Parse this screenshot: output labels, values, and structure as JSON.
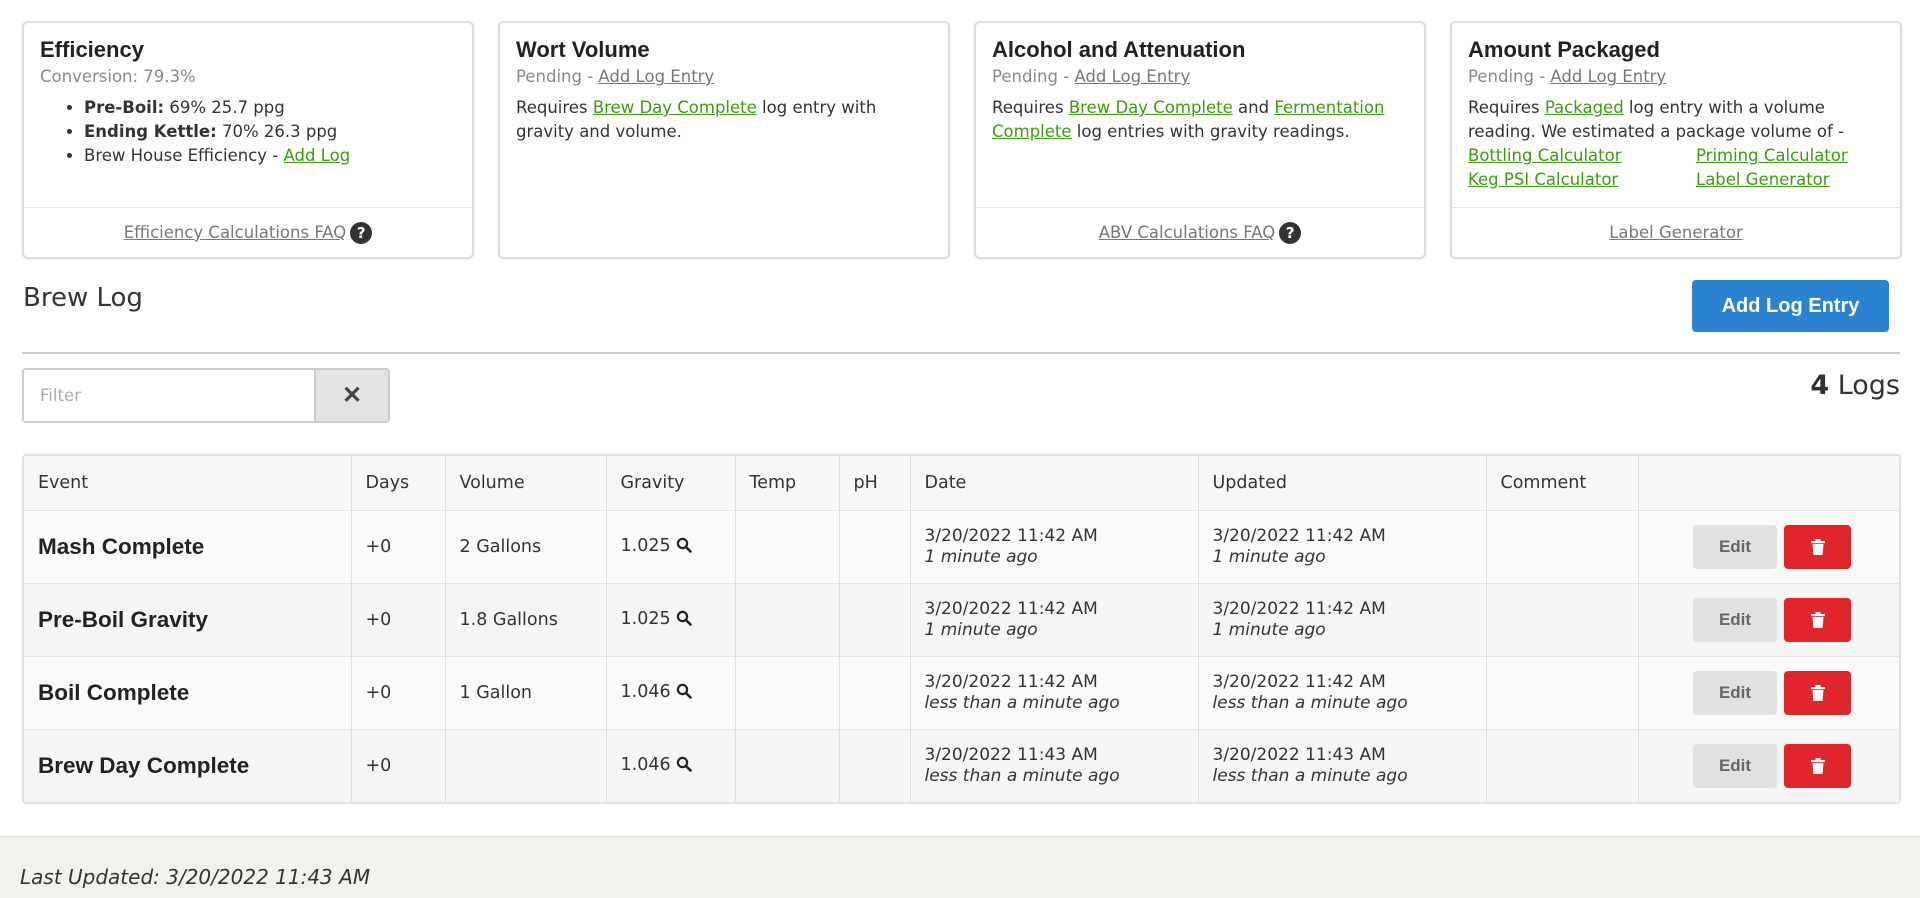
{
  "cards": {
    "efficiency": {
      "title": "Efficiency",
      "subtitle": "Conversion: 79.3%",
      "pre_boil_label": "Pre-Boil:",
      "pre_boil_value": "69% 25.7 ppg",
      "ending_kettle_label": "Ending Kettle:",
      "ending_kettle_value": "70% 26.3 ppg",
      "brew_house_label": "Brew House Efficiency - ",
      "brew_house_link": "Add Log",
      "footer_link": "Efficiency Calculations FAQ"
    },
    "wort_volume": {
      "title": "Wort Volume",
      "pending": "Pending - ",
      "pending_link": "Add Log Entry",
      "text_1": "Requires ",
      "link_1": "Brew Day Complete",
      "text_2": " log entry with gravity and volume."
    },
    "alcohol": {
      "title": "Alcohol and Attenuation",
      "pending": "Pending - ",
      "pending_link": "Add Log Entry",
      "text_1": "Requires ",
      "link_1": "Brew Day Complete",
      "text_2": " and ",
      "link_2": "Fermentation Complete",
      "text_3": " log entries with gravity readings.",
      "footer_link": "ABV Calculations FAQ"
    },
    "packaged": {
      "title": "Amount Packaged",
      "pending": "Pending - ",
      "pending_link": "Add Log Entry",
      "text_1": "Requires ",
      "link_1": "Packaged",
      "text_2": " log entry with a volume reading. We estimated a package volume of -",
      "calc_1": "Bottling Calculator",
      "calc_2": "Priming Calculator",
      "calc_3": "Keg PSI Calculator",
      "calc_4": "Label Generator",
      "footer_link": "Label Generator"
    }
  },
  "brew_log": {
    "title": "Brew Log",
    "add_button": "Add Log Entry",
    "filter_placeholder": "Filter",
    "clear_label": "✕",
    "log_count": "4",
    "log_count_label": " Logs"
  },
  "table": {
    "headers": [
      "Event",
      "Days",
      "Volume",
      "Gravity",
      "Temp",
      "pH",
      "Date",
      "Updated",
      "Comment",
      ""
    ],
    "rows": [
      {
        "event": "Mash Complete",
        "days": "+0",
        "volume": "2 Gallons",
        "gravity": "1.025",
        "temp": "",
        "ph": "",
        "date": "3/20/2022 11:42 AM",
        "date_rel": "1 minute ago",
        "updated": "3/20/2022 11:42 AM",
        "updated_rel": "1 minute ago",
        "comment": ""
      },
      {
        "event": "Pre-Boil Gravity",
        "days": "+0",
        "volume": "1.8 Gallons",
        "gravity": "1.025",
        "temp": "",
        "ph": "",
        "date": "3/20/2022 11:42 AM",
        "date_rel": "1 minute ago",
        "updated": "3/20/2022 11:42 AM",
        "updated_rel": "1 minute ago",
        "comment": ""
      },
      {
        "event": "Boil Complete",
        "days": "+0",
        "volume": "1 Gallon",
        "gravity": "1.046",
        "temp": "",
        "ph": "",
        "date": "3/20/2022 11:42 AM",
        "date_rel": "less than a minute ago",
        "updated": "3/20/2022 11:42 AM",
        "updated_rel": "less than a minute ago",
        "comment": ""
      },
      {
        "event": "Brew Day Complete",
        "days": "+0",
        "volume": "",
        "gravity": "1.046",
        "temp": "",
        "ph": "",
        "date": "3/20/2022 11:43 AM",
        "date_rel": "less than a minute ago",
        "updated": "3/20/2022 11:43 AM",
        "updated_rel": "less than a minute ago",
        "comment": ""
      }
    ],
    "edit_label": "Edit"
  },
  "footer": {
    "last_updated": "Last Updated: 3/20/2022 11:43 AM"
  },
  "colors": {
    "link_green": "#3a9b0f",
    "primary_blue": "#2a82d1",
    "danger_red": "#e0252b"
  }
}
